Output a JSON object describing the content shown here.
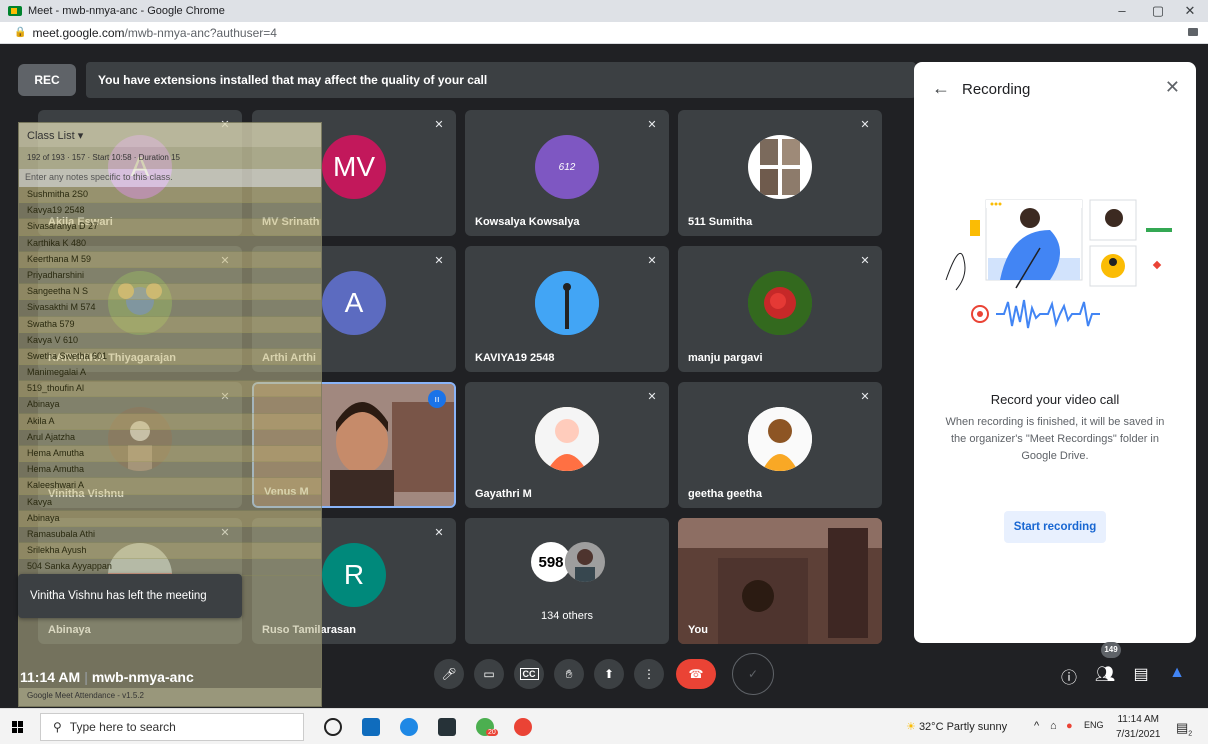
{
  "browser": {
    "window_title": "Meet - mwb-nmya-anc - Google Chrome",
    "url_host": "meet.google.com",
    "url_path": "/mwb-nmya-anc?authuser=4",
    "minimize": "–",
    "maximize": "▢",
    "close": "✕"
  },
  "meet": {
    "rec_label": "REC",
    "extension_banner": "You have extensions installed that may affect the quality of your call",
    "tiles": [
      {
        "name": "Akila Eswari",
        "initial": "A",
        "color": "#a142f4"
      },
      {
        "name": "MV Srinath",
        "initial": "MV",
        "color": "#c2185b"
      },
      {
        "name": "Kowsalya Kowsalya",
        "initial": "612",
        "color": "#7e57c2"
      },
      {
        "name": "511 Sumitha",
        "initial": "",
        "color": "#9e8a78"
      },
      {
        "name": "KARTHIKA Thiyagarajan",
        "initial": "",
        "color": "#4a7a3c"
      },
      {
        "name": "Arthi Arthi",
        "initial": "A",
        "color": "#5c6bc0"
      },
      {
        "name": "KAVIYA19 2548",
        "initial": "",
        "color": "#1e88e5"
      },
      {
        "name": "manju pargavi",
        "initial": "",
        "color": "#2e7d32"
      },
      {
        "name": "Vinitha Vishnu",
        "initial": "",
        "color": "#5d4037"
      },
      {
        "name": "Venus M",
        "initial": "",
        "color": "#8d6e63"
      },
      {
        "name": "Gayathri M",
        "initial": "",
        "color": "#ff7043"
      },
      {
        "name": "geetha geetha",
        "initial": "",
        "color": "#3e2723"
      },
      {
        "name": "Abinaya",
        "initial": "",
        "color": "#78909c"
      },
      {
        "name": "Ruso Tamilarasan",
        "initial": "R",
        "color": "#00897b"
      },
      {
        "name": "134 others",
        "initial": "598",
        "color": "#ffffff"
      },
      {
        "name": "You",
        "initial": "",
        "color": "#6d4c41"
      }
    ],
    "toast": "Vinitha Vishnu has left the meeting",
    "time": "11:14 AM",
    "meeting_code": "mwb-nmya-anc",
    "participant_count": "149"
  },
  "attendance": {
    "header": "Class List",
    "toolbar": "192 of 193  ·  157  ·  Start 10:58  ·  Duration 15",
    "note_placeholder": "Enter any notes specific to this class.",
    "rows": [
      "Sushmitha 2S0",
      "Kavya19 2548",
      "Sivasaranya D 27",
      "Karthika K 480",
      "Keerthana M 59",
      "Priyadharshini",
      "Sangeetha N S",
      "Sivasakthi M 574",
      "Swatha 579",
      "Kavya V 610",
      "Swetha Swetha 601",
      "Manimegalai A",
      "519_thoufin Al",
      "Abinaya",
      "Akila A",
      "Arul Ajatzha",
      "Hema Amutha",
      "Hema Amutha",
      "Kaleeshwari A",
      "Kavya",
      "Abinaya",
      "Ramasubala Athi",
      "Srilekha Ayush",
      "504 Sanka Ayyappan"
    ],
    "footer": "Google Meet Attendance - v1.5.2"
  },
  "recording_panel": {
    "title": "Recording",
    "heading": "Record your video call",
    "description": "When recording is finished, it will be saved in the organizer's \"Meet Recordings\" folder in Google Drive.",
    "button": "Start recording"
  },
  "taskbar": {
    "search_placeholder": "Type here to search",
    "weather": "32°C  Partly sunny",
    "lang": "ENG",
    "time": "11:14 AM",
    "date": "7/31/2021",
    "notif_count": "2",
    "chrome_badge": "20"
  }
}
